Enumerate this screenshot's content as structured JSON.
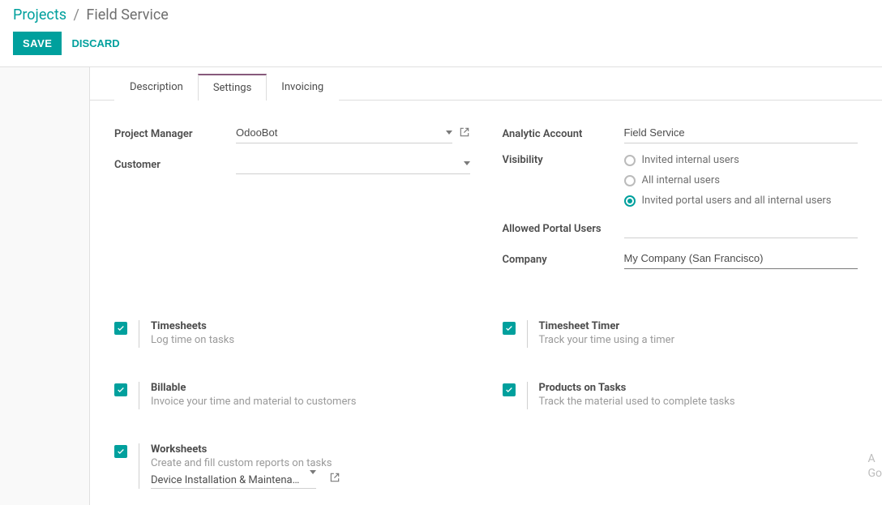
{
  "breadcrumb": {
    "root": "Projects",
    "current": "Field Service"
  },
  "actions": {
    "save": "SAVE",
    "discard": "DISCARD"
  },
  "tabs": {
    "description": "Description",
    "settings": "Settings",
    "invoicing": "Invoicing",
    "active": "settings"
  },
  "left_fields": {
    "project_manager_label": "Project Manager",
    "project_manager_value": "OdooBot",
    "customer_label": "Customer",
    "customer_value": ""
  },
  "right_fields": {
    "analytic_account_label": "Analytic Account",
    "analytic_account_value": "Field Service",
    "visibility_label": "Visibility",
    "visibility_options": {
      "opt0": "Invited internal users",
      "opt1": "All internal users",
      "opt2": "Invited portal users and all internal users"
    },
    "visibility_selected": 2,
    "allowed_portal_users_label": "Allowed Portal Users",
    "company_label": "Company",
    "company_value": "My Company (San Francisco)"
  },
  "options": {
    "timesheets": {
      "title": "Timesheets",
      "desc": "Log time on tasks",
      "checked": true
    },
    "billable": {
      "title": "Billable",
      "desc": "Invoice your time and material to customers",
      "checked": true
    },
    "worksheets": {
      "title": "Worksheets",
      "desc": "Create and fill custom reports on tasks",
      "checked": true,
      "select_value": "Device Installation & Maintenance"
    },
    "timesheet_timer": {
      "title": "Timesheet Timer",
      "desc": "Track your time using a timer",
      "checked": true
    },
    "products_on_tasks": {
      "title": "Products on Tasks",
      "desc": "Track the material used to complete tasks",
      "checked": true
    }
  },
  "side_hint": {
    "line1": "A",
    "line2": "Go"
  }
}
